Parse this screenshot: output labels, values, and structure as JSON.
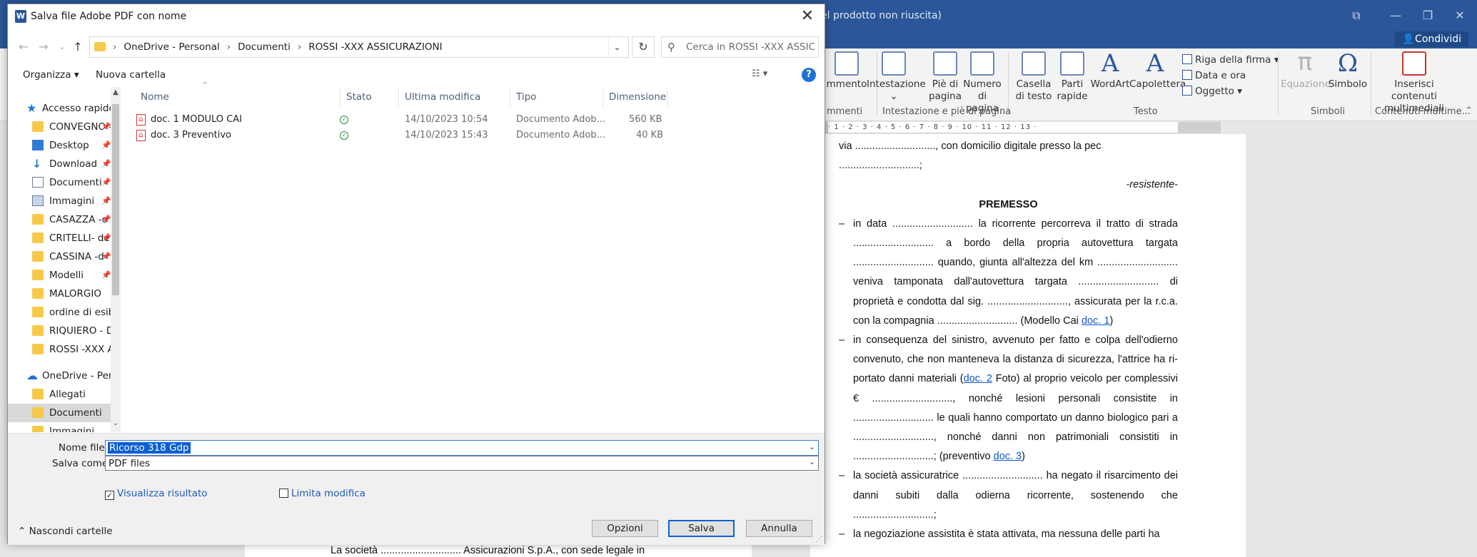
{
  "word": {
    "title_fragment": "el prodotto non riuscita)",
    "share_label": "Condividi",
    "ribbon": {
      "buttons": [
        {
          "id": "commento",
          "label": "mmento"
        },
        {
          "id": "intestazione",
          "label": "Intestazione",
          "sub": "⌄"
        },
        {
          "id": "pie",
          "label": "Piè di pagina",
          "sub": "⌄"
        },
        {
          "id": "numero",
          "label": "Numero di pagina",
          "sub": "⌄"
        },
        {
          "id": "casella",
          "label": "Casella di testo",
          "sub": "⌄"
        },
        {
          "id": "parti",
          "label": "Parti rapide",
          "sub": "⌄"
        },
        {
          "id": "wordart",
          "label": "WordArt",
          "sub": "⌄"
        },
        {
          "id": "capolettera",
          "label": "Capolettera",
          "sub": "⌄"
        },
        {
          "id": "equazione",
          "label": "Equazione",
          "sub": "⌄"
        },
        {
          "id": "simbolo",
          "label": "Simbolo",
          "sub": "⌄"
        },
        {
          "id": "inserisci",
          "label": "Inserisci contenuti multimediali"
        }
      ],
      "small": {
        "riga_firma": "Riga della firma",
        "data_ora": "Data e ora",
        "oggetto": "Oggetto"
      },
      "groups": {
        "commenti": "mmenti",
        "intestazione": "Intestazione e piè di pagina",
        "testo": "Testo",
        "simboli": "Simboli",
        "contenuti": "Contenuti multime..."
      }
    },
    "ruler_text": "· 1 · 2 · 3 · 4 · 5 · 6 · 7 · 8 · 9 · 10 · 11 · 12 · 13 ·",
    "doc": {
      "l1": "via ............................, con domicilio digitale presso la pec",
      "l2": "............................;",
      "resistente": "-resistente-",
      "premesso": "PREMESSO",
      "b1": "in data ............................ la ricorrente percorreva il tratto di strada ............................ a bordo della propria autovettura targata ............................ quando, giunta all'altezza del km ............................ veniva tamponata dall'autovettura targata ............................ di proprietà e condotta dal sig. ............................, assicurata per la r.c.a. con la compagnia ............................ (Modello Cai ",
      "b1_link": "doc. 1",
      "b1_end": ")",
      "b2": "in consequenza del sinistro, avvenuto per fatto e colpa dell'odierno convenuto, che non manteneva la distanza di sicurezza, l'attrice ha ri- portato danni materiali (",
      "b2_link": "doc. 2",
      "b2_mid": " Foto) al proprio veicolo per complessivi € ............................, nonché lesioni personali consistite in ............................ le quali hanno comportato un danno biologico pari a ............................, nonché danni non patrimoniali consistiti in ............................; (preventivo ",
      "b2_link2": "doc. 3",
      "b2_end": ")",
      "b3": "la società assicuratrice ............................ ha negato il risarcimento dei danni subiti dalla odierna ricorrente, sostenendo che ............................;",
      "b4": "la negoziazione assistita è stata attivata, ma nessuna delle parti ha",
      "left_page": "La società ............................ Assicurazioni S.p.A., con sede legale in"
    }
  },
  "dialog": {
    "title": "Salva file Adobe PDF con nome",
    "close": "✕",
    "breadcrumb": [
      "OneDrive - Personal",
      "Documenti",
      "ROSSI -XXX ASSICURAZIONI"
    ],
    "search_placeholder": "Cerca in ROSSI -XXX ASSICU...",
    "toolbar": {
      "organize": "Organizza ▾",
      "new_folder": "Nuova cartella",
      "help": "?"
    },
    "nav_items": [
      {
        "label": "Accesso rapido",
        "icon": "star-icon"
      },
      {
        "label": "CONVEGNO -c",
        "icon": "folder-icon",
        "pin": true
      },
      {
        "label": "Desktop",
        "icon": "desktop-icon",
        "pin": true
      },
      {
        "label": "Download",
        "icon": "download-icon",
        "pin": true
      },
      {
        "label": "Documenti",
        "icon": "document-icon",
        "pin": true
      },
      {
        "label": "Immagini",
        "icon": "image-icon",
        "pin": true
      },
      {
        "label": "CASAZZA -c",
        "icon": "folder-icon",
        "pin": true
      },
      {
        "label": "CRITELLI- de",
        "icon": "folder-icon",
        "pin": true
      },
      {
        "label": "CASSINA -d",
        "icon": "folder-icon",
        "pin": true
      },
      {
        "label": "Modelli",
        "icon": "folder-icon",
        "pin": true
      },
      {
        "label": "MALORGIO",
        "icon": "folder-icon"
      },
      {
        "label": "ordine di esibiz",
        "icon": "folder-icon"
      },
      {
        "label": "RIQUIERO - DEF",
        "icon": "folder-icon"
      },
      {
        "label": "ROSSI -XXX ASS",
        "icon": "folder-icon"
      },
      {
        "label": "OneDrive - Perso",
        "icon": "cloud-icon"
      },
      {
        "label": "Allegati",
        "icon": "folder-icon"
      },
      {
        "label": "Documenti",
        "icon": "folder-icon",
        "selected": true
      },
      {
        "label": "Immagini",
        "icon": "folder-icon"
      }
    ],
    "columns": [
      "Nome",
      "Stato",
      "Ultima modifica",
      "Tipo",
      "Dimensione"
    ],
    "files": [
      {
        "name": "doc. 1 MODULO CAI",
        "status": "✓",
        "modified": "14/10/2023 10:54",
        "type": "Documento Adob...",
        "size": "560 KB"
      },
      {
        "name": "doc. 3 Preventivo",
        "status": "✓",
        "modified": "14/10/2023 15:43",
        "type": "Documento Adob...",
        "size": "40 KB"
      }
    ],
    "filename_label": "Nome file:",
    "filename_value": "Ricorso 318 Gdp",
    "savetype_label": "Salva come:",
    "savetype_value": "PDF files",
    "view_result": "Visualizza risultato",
    "limit_edit": "Limita modifica",
    "hide_folders": "Nascondi cartelle",
    "options": "Opzioni",
    "save": "Salva",
    "cancel": "Annulla"
  }
}
